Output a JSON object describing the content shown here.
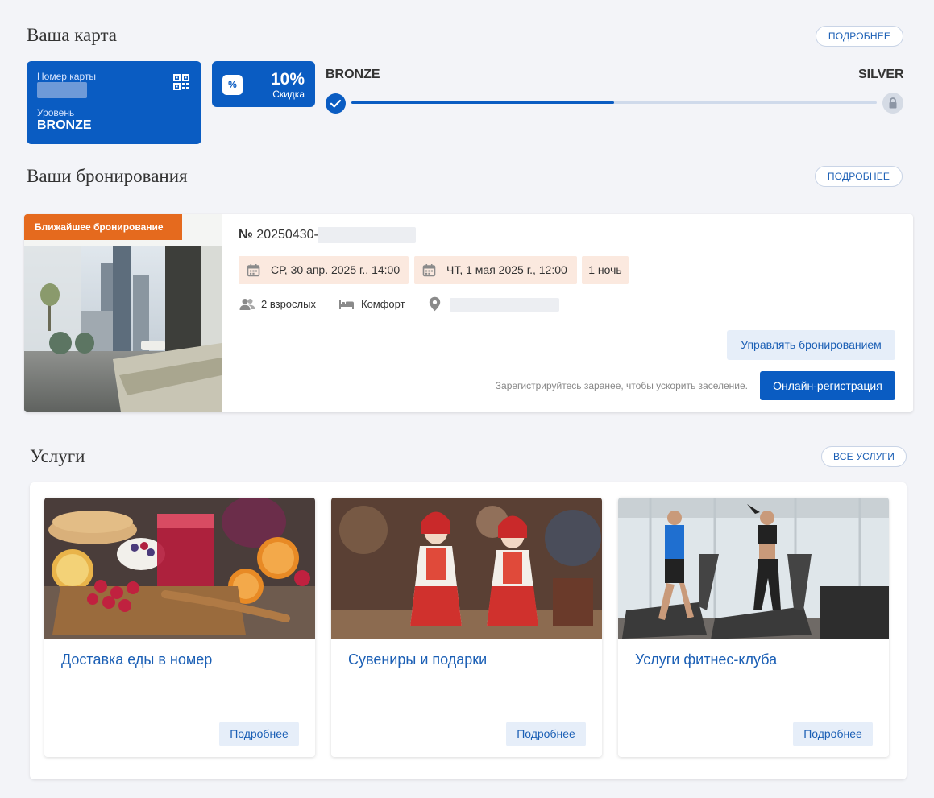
{
  "card_section": {
    "title": "Ваша карта",
    "more_label": "ПОДРОБНЕЕ",
    "card": {
      "number_label": "Номер карты",
      "level_label": "Уровень",
      "level_value": "BRONZE"
    },
    "discount": {
      "value": "10%",
      "label": "Скидка",
      "icon_text": "%"
    },
    "progress": {
      "current_level": "BRONZE",
      "next_level": "SILVER",
      "progress_fraction": 0.5
    }
  },
  "bookings_section": {
    "title": "Ваши бронирования",
    "more_label": "ПОДРОБНЕЕ",
    "booking": {
      "badge": "Ближайшее бронирование",
      "number_prefix": "№",
      "number": "20250430-",
      "checkin": "СР, 30 апр. 2025 г., 14:00",
      "checkout": "ЧТ, 1 мая 2025 г., 12:00",
      "nights": "1 ночь",
      "guests": "2 взрослых",
      "room_type": "Комфорт",
      "manage_label": "Управлять бронированием",
      "hint": "Зарегистрируйтесь заранее, чтобы ускорить заселение.",
      "online_label": "Онлайн-регистрация"
    }
  },
  "services_section": {
    "title": "Услуги",
    "all_label": "ВСЕ УСЛУГИ",
    "items": [
      {
        "title": "Доставка еды в номер",
        "button": "Подробнее"
      },
      {
        "title": "Сувениры и подарки",
        "button": "Подробнее"
      },
      {
        "title": "Услуги фитнес-клуба",
        "button": "Подробнее"
      }
    ]
  },
  "colors": {
    "primary": "#0a5cc2",
    "accent_orange": "#e56a1e",
    "date_chip_bg": "#fbe9df",
    "link_blue": "#1b5fb5",
    "page_bg": "#f3f4f8"
  },
  "icons": [
    "qr-code-icon",
    "percent-icon",
    "check-icon",
    "lock-icon",
    "calendar-icon",
    "guests-icon",
    "bed-icon",
    "location-pin-icon"
  ]
}
